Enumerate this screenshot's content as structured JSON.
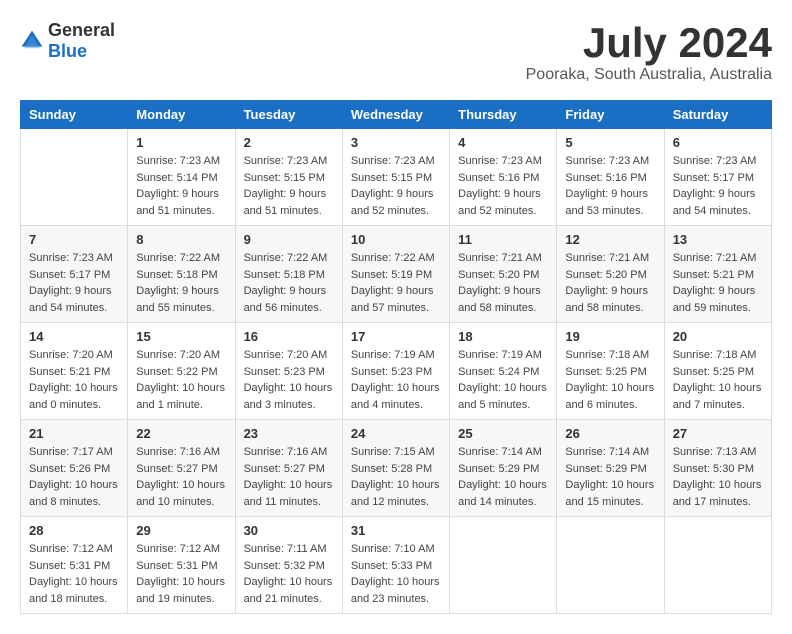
{
  "logo": {
    "general": "General",
    "blue": "Blue"
  },
  "header": {
    "month": "July 2024",
    "location": "Pooraka, South Australia, Australia"
  },
  "weekdays": [
    "Sunday",
    "Monday",
    "Tuesday",
    "Wednesday",
    "Thursday",
    "Friday",
    "Saturday"
  ],
  "weeks": [
    [
      {
        "day": "",
        "sunrise": "",
        "sunset": "",
        "daylight": ""
      },
      {
        "day": "1",
        "sunrise": "Sunrise: 7:23 AM",
        "sunset": "Sunset: 5:14 PM",
        "daylight": "Daylight: 9 hours and 51 minutes."
      },
      {
        "day": "2",
        "sunrise": "Sunrise: 7:23 AM",
        "sunset": "Sunset: 5:15 PM",
        "daylight": "Daylight: 9 hours and 51 minutes."
      },
      {
        "day": "3",
        "sunrise": "Sunrise: 7:23 AM",
        "sunset": "Sunset: 5:15 PM",
        "daylight": "Daylight: 9 hours and 52 minutes."
      },
      {
        "day": "4",
        "sunrise": "Sunrise: 7:23 AM",
        "sunset": "Sunset: 5:16 PM",
        "daylight": "Daylight: 9 hours and 52 minutes."
      },
      {
        "day": "5",
        "sunrise": "Sunrise: 7:23 AM",
        "sunset": "Sunset: 5:16 PM",
        "daylight": "Daylight: 9 hours and 53 minutes."
      },
      {
        "day": "6",
        "sunrise": "Sunrise: 7:23 AM",
        "sunset": "Sunset: 5:17 PM",
        "daylight": "Daylight: 9 hours and 54 minutes."
      }
    ],
    [
      {
        "day": "7",
        "sunrise": "Sunrise: 7:23 AM",
        "sunset": "Sunset: 5:17 PM",
        "daylight": "Daylight: 9 hours and 54 minutes."
      },
      {
        "day": "8",
        "sunrise": "Sunrise: 7:22 AM",
        "sunset": "Sunset: 5:18 PM",
        "daylight": "Daylight: 9 hours and 55 minutes."
      },
      {
        "day": "9",
        "sunrise": "Sunrise: 7:22 AM",
        "sunset": "Sunset: 5:18 PM",
        "daylight": "Daylight: 9 hours and 56 minutes."
      },
      {
        "day": "10",
        "sunrise": "Sunrise: 7:22 AM",
        "sunset": "Sunset: 5:19 PM",
        "daylight": "Daylight: 9 hours and 57 minutes."
      },
      {
        "day": "11",
        "sunrise": "Sunrise: 7:21 AM",
        "sunset": "Sunset: 5:20 PM",
        "daylight": "Daylight: 9 hours and 58 minutes."
      },
      {
        "day": "12",
        "sunrise": "Sunrise: 7:21 AM",
        "sunset": "Sunset: 5:20 PM",
        "daylight": "Daylight: 9 hours and 58 minutes."
      },
      {
        "day": "13",
        "sunrise": "Sunrise: 7:21 AM",
        "sunset": "Sunset: 5:21 PM",
        "daylight": "Daylight: 9 hours and 59 minutes."
      }
    ],
    [
      {
        "day": "14",
        "sunrise": "Sunrise: 7:20 AM",
        "sunset": "Sunset: 5:21 PM",
        "daylight": "Daylight: 10 hours and 0 minutes."
      },
      {
        "day": "15",
        "sunrise": "Sunrise: 7:20 AM",
        "sunset": "Sunset: 5:22 PM",
        "daylight": "Daylight: 10 hours and 1 minute."
      },
      {
        "day": "16",
        "sunrise": "Sunrise: 7:20 AM",
        "sunset": "Sunset: 5:23 PM",
        "daylight": "Daylight: 10 hours and 3 minutes."
      },
      {
        "day": "17",
        "sunrise": "Sunrise: 7:19 AM",
        "sunset": "Sunset: 5:23 PM",
        "daylight": "Daylight: 10 hours and 4 minutes."
      },
      {
        "day": "18",
        "sunrise": "Sunrise: 7:19 AM",
        "sunset": "Sunset: 5:24 PM",
        "daylight": "Daylight: 10 hours and 5 minutes."
      },
      {
        "day": "19",
        "sunrise": "Sunrise: 7:18 AM",
        "sunset": "Sunset: 5:25 PM",
        "daylight": "Daylight: 10 hours and 6 minutes."
      },
      {
        "day": "20",
        "sunrise": "Sunrise: 7:18 AM",
        "sunset": "Sunset: 5:25 PM",
        "daylight": "Daylight: 10 hours and 7 minutes."
      }
    ],
    [
      {
        "day": "21",
        "sunrise": "Sunrise: 7:17 AM",
        "sunset": "Sunset: 5:26 PM",
        "daylight": "Daylight: 10 hours and 8 minutes."
      },
      {
        "day": "22",
        "sunrise": "Sunrise: 7:16 AM",
        "sunset": "Sunset: 5:27 PM",
        "daylight": "Daylight: 10 hours and 10 minutes."
      },
      {
        "day": "23",
        "sunrise": "Sunrise: 7:16 AM",
        "sunset": "Sunset: 5:27 PM",
        "daylight": "Daylight: 10 hours and 11 minutes."
      },
      {
        "day": "24",
        "sunrise": "Sunrise: 7:15 AM",
        "sunset": "Sunset: 5:28 PM",
        "daylight": "Daylight: 10 hours and 12 minutes."
      },
      {
        "day": "25",
        "sunrise": "Sunrise: 7:14 AM",
        "sunset": "Sunset: 5:29 PM",
        "daylight": "Daylight: 10 hours and 14 minutes."
      },
      {
        "day": "26",
        "sunrise": "Sunrise: 7:14 AM",
        "sunset": "Sunset: 5:29 PM",
        "daylight": "Daylight: 10 hours and 15 minutes."
      },
      {
        "day": "27",
        "sunrise": "Sunrise: 7:13 AM",
        "sunset": "Sunset: 5:30 PM",
        "daylight": "Daylight: 10 hours and 17 minutes."
      }
    ],
    [
      {
        "day": "28",
        "sunrise": "Sunrise: 7:12 AM",
        "sunset": "Sunset: 5:31 PM",
        "daylight": "Daylight: 10 hours and 18 minutes."
      },
      {
        "day": "29",
        "sunrise": "Sunrise: 7:12 AM",
        "sunset": "Sunset: 5:31 PM",
        "daylight": "Daylight: 10 hours and 19 minutes."
      },
      {
        "day": "30",
        "sunrise": "Sunrise: 7:11 AM",
        "sunset": "Sunset: 5:32 PM",
        "daylight": "Daylight: 10 hours and 21 minutes."
      },
      {
        "day": "31",
        "sunrise": "Sunrise: 7:10 AM",
        "sunset": "Sunset: 5:33 PM",
        "daylight": "Daylight: 10 hours and 23 minutes."
      },
      {
        "day": "",
        "sunrise": "",
        "sunset": "",
        "daylight": ""
      },
      {
        "day": "",
        "sunrise": "",
        "sunset": "",
        "daylight": ""
      },
      {
        "day": "",
        "sunrise": "",
        "sunset": "",
        "daylight": ""
      }
    ]
  ]
}
